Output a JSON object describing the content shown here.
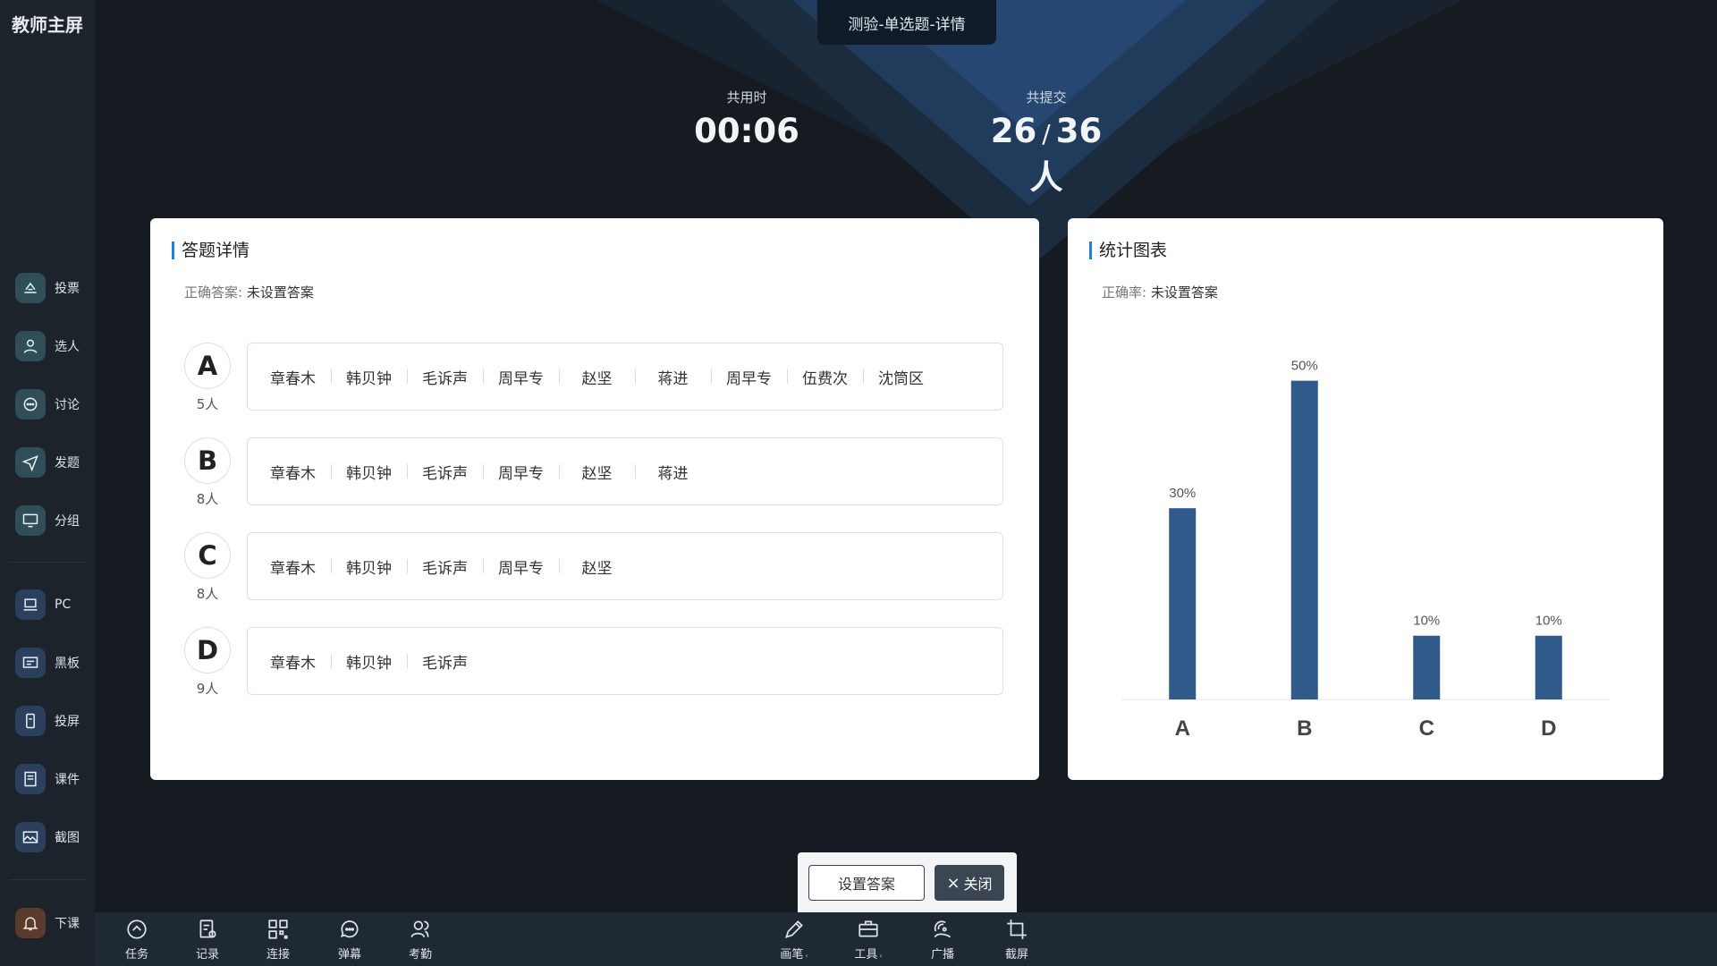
{
  "app": {
    "title": "教师主屏"
  },
  "sidebar": {
    "items": [
      {
        "label": "投票",
        "icon": "vote-icon"
      },
      {
        "label": "选人",
        "icon": "person-icon"
      },
      {
        "label": "讨论",
        "icon": "chat-icon"
      },
      {
        "label": "发题",
        "icon": "send-icon"
      },
      {
        "label": "分组",
        "icon": "monitor-icon"
      },
      {
        "label": "PC",
        "icon": "laptop-icon"
      },
      {
        "label": "黑板",
        "icon": "board-icon"
      },
      {
        "label": "投屏",
        "icon": "phone-cast-icon"
      },
      {
        "label": "课件",
        "icon": "courseware-icon"
      },
      {
        "label": "截图",
        "icon": "image-icon"
      },
      {
        "label": "下课",
        "icon": "bell-icon"
      }
    ]
  },
  "header": {
    "tab_title": "测验-单选题-详情"
  },
  "stats": {
    "time_label": "共用时",
    "time_value": "00:06",
    "submit_label": "共提交",
    "submitted": "26",
    "separator": "/",
    "total": "36人"
  },
  "detail": {
    "title": "答题详情",
    "answer_key": "正确答案:",
    "answer_value": "未设置答案",
    "options": [
      {
        "letter": "A",
        "count": "5人",
        "names": [
          "章春木",
          "韩贝钟",
          "毛诉声",
          "周早专",
          "赵坚",
          "蒋进",
          "周早专",
          "伍费次",
          "沈筒区"
        ]
      },
      {
        "letter": "B",
        "count": "8人",
        "names": [
          "章春木",
          "韩贝钟",
          "毛诉声",
          "周早专",
          "赵坚",
          "蒋进"
        ]
      },
      {
        "letter": "C",
        "count": "8人",
        "names": [
          "章春木",
          "韩贝钟",
          "毛诉声",
          "周早专",
          "赵坚"
        ]
      },
      {
        "letter": "D",
        "count": "9人",
        "names": [
          "章春木",
          "韩贝钟",
          "毛诉声"
        ]
      }
    ]
  },
  "chart_panel": {
    "title": "统计图表",
    "rate_key": "正确率:",
    "rate_value": "未设置答案"
  },
  "chart_data": {
    "type": "bar",
    "categories": [
      "A",
      "B",
      "C",
      "D"
    ],
    "values": [
      30,
      50,
      10,
      10
    ],
    "value_labels": [
      "30%",
      "50%",
      "10%",
      "10%"
    ],
    "ylim": [
      0,
      55
    ],
    "bar_color": "#2f5a8a",
    "grid": false,
    "title": "",
    "xlabel": "",
    "ylabel": ""
  },
  "actions": {
    "set_answer": "设置答案",
    "close": "关闭",
    "close_icon": "×"
  },
  "toolbar": {
    "left": [
      {
        "label": "任务",
        "icon": "task-icon"
      },
      {
        "label": "记录",
        "icon": "record-icon"
      },
      {
        "label": "连接",
        "icon": "qrcode-icon"
      },
      {
        "label": "弹幕",
        "icon": "danmaku-icon"
      },
      {
        "label": "考勤",
        "icon": "attendance-icon"
      }
    ],
    "right": [
      {
        "label": "画笔",
        "icon": "pen-icon",
        "caret": "‹"
      },
      {
        "label": "工具",
        "icon": "toolbox-icon",
        "caret": "‹"
      },
      {
        "label": "广播",
        "icon": "broadcast-icon",
        "caret": ""
      },
      {
        "label": "截屏",
        "icon": "crop-icon",
        "caret": ""
      }
    ]
  }
}
